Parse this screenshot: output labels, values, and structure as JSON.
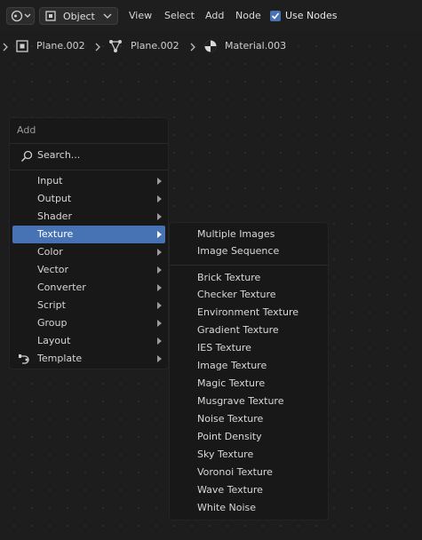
{
  "header": {
    "editor_type_icon": "node-editor-icon",
    "mode": "Object",
    "menus": [
      "View",
      "Select",
      "Add",
      "Node"
    ],
    "use_nodes_label": "Use Nodes",
    "use_nodes_checked": true,
    "accent": "#4772b3"
  },
  "breadcrumb": {
    "items": [
      {
        "label": "Plane.002",
        "icon": "object-icon"
      },
      {
        "label": "Plane.002",
        "icon": "mesh-data-icon"
      },
      {
        "label": "Material.003",
        "icon": "material-icon"
      }
    ]
  },
  "add_menu": {
    "title": "Add",
    "search_label": "Search...",
    "items": [
      {
        "label": "Input"
      },
      {
        "label": "Output"
      },
      {
        "label": "Shader"
      },
      {
        "label": "Texture",
        "active": true
      },
      {
        "label": "Color"
      },
      {
        "label": "Vector"
      },
      {
        "label": "Converter"
      },
      {
        "label": "Script"
      },
      {
        "label": "Group"
      },
      {
        "label": "Layout"
      },
      {
        "label": "Template",
        "icon": "template-icon"
      }
    ]
  },
  "texture_submenu": {
    "top_items": [
      "Multiple Images",
      "Image Sequence"
    ],
    "items": [
      "Brick Texture",
      "Checker Texture",
      "Environment Texture",
      "Gradient Texture",
      "IES Texture",
      "Image Texture",
      "Magic Texture",
      "Musgrave Texture",
      "Noise Texture",
      "Point Density",
      "Sky Texture",
      "Voronoi Texture",
      "Wave Texture",
      "White Noise"
    ]
  }
}
